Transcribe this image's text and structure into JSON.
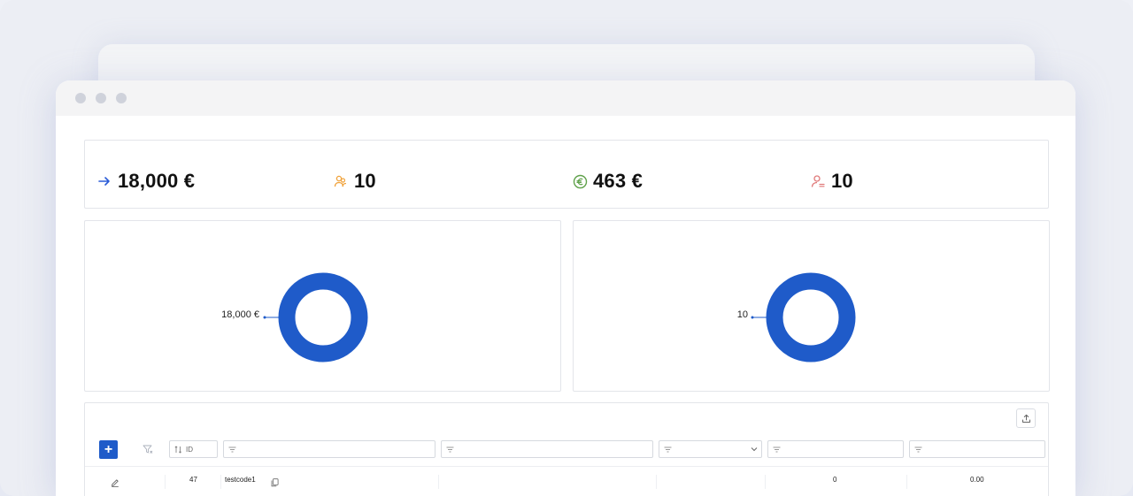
{
  "window": {
    "controls": [
      "dot",
      "dot",
      "dot"
    ]
  },
  "kpis": [
    {
      "icon": "arrow-right-icon",
      "value": "18,000 €",
      "color": "#2a5bd7"
    },
    {
      "icon": "users-icon",
      "value": "10",
      "color": "#f0a23b"
    },
    {
      "icon": "euro-circle-icon",
      "value": "463 €",
      "color": "#5fa14a"
    },
    {
      "icon": "user-minus-icon",
      "value": "10",
      "color": "#e07a7a"
    }
  ],
  "charts": [
    {
      "type": "donut",
      "label": "18,000 €",
      "color": "#1f5bc9"
    },
    {
      "type": "donut",
      "label": "10",
      "color": "#1f5bc9"
    }
  ],
  "table": {
    "add_label": "+",
    "filters": {
      "id_placeholder": "ID"
    },
    "rows": [
      {
        "id": "47",
        "code": "testcode1",
        "count": "0",
        "amount": "0.00"
      }
    ]
  },
  "colors": {
    "accent": "#1f5bc9",
    "border": "#e3e5ea"
  }
}
